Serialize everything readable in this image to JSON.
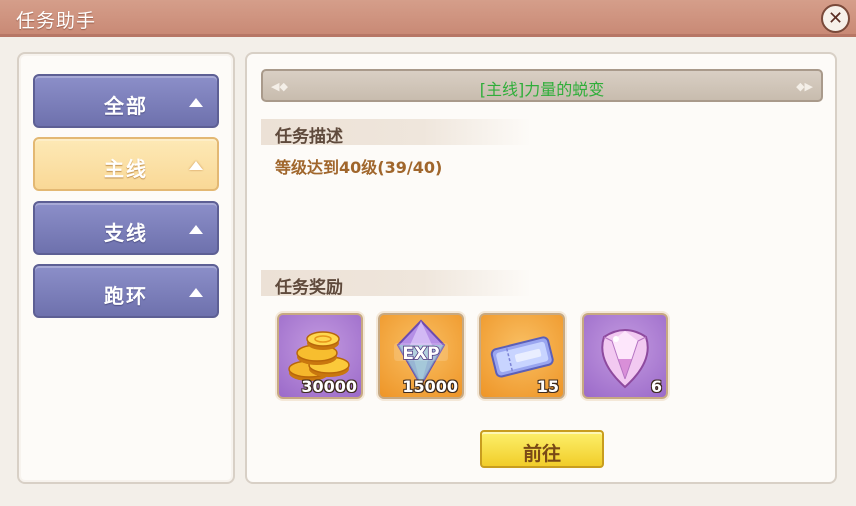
{
  "window": {
    "title": "任务助手"
  },
  "tabs": [
    {
      "label": "全部"
    },
    {
      "label": "主线"
    },
    {
      "label": "支线"
    },
    {
      "label": "跑环"
    }
  ],
  "active_tab": "主线",
  "quest": {
    "title": "[主线]力量的蜕变",
    "description_heading": "任务描述",
    "description": "等级达到40级(39/40)",
    "rewards_heading": "任务奖励",
    "rewards": [
      {
        "icon": "gold-coins-icon",
        "count": "30000"
      },
      {
        "icon": "exp-crystal-icon",
        "count": "15000"
      },
      {
        "icon": "ticket-icon",
        "count": "15"
      },
      {
        "icon": "gem-icon",
        "count": "6"
      }
    ]
  },
  "go_button": "前往",
  "colors": {
    "title_bar": "#c98a76",
    "tab": "#7b7eba",
    "tab_active": "#fbe0a4",
    "quest_title": "#2fae3a",
    "button": "#f6df45"
  }
}
